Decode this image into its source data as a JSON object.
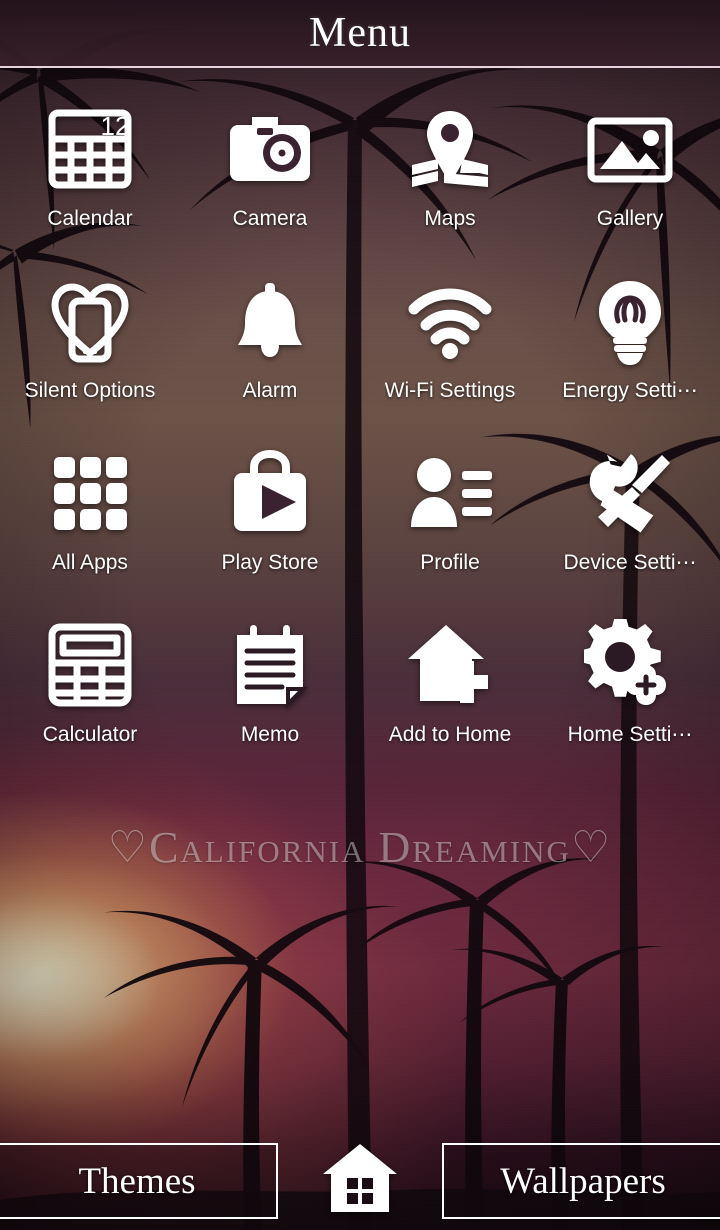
{
  "header": {
    "title": "Menu"
  },
  "apps": [
    {
      "label": "Calendar",
      "icon": "calendar-icon",
      "badge": "12"
    },
    {
      "label": "Camera",
      "icon": "camera-icon"
    },
    {
      "label": "Maps",
      "icon": "map-pin-icon"
    },
    {
      "label": "Gallery",
      "icon": "photo-icon"
    },
    {
      "label": "Silent Options",
      "icon": "heart-phone-icon"
    },
    {
      "label": "Alarm",
      "icon": "bell-icon"
    },
    {
      "label": "Wi-Fi Settings",
      "icon": "wifi-icon"
    },
    {
      "label": "Energy Setti⋯",
      "icon": "lightbulb-icon"
    },
    {
      "label": "All Apps",
      "icon": "grid-apps-icon"
    },
    {
      "label": "Play Store",
      "icon": "play-store-bag-icon"
    },
    {
      "label": "Profile",
      "icon": "person-list-icon"
    },
    {
      "label": "Device Setti⋯",
      "icon": "wrench-screwdriver-icon"
    },
    {
      "label": "Calculator",
      "icon": "calculator-icon"
    },
    {
      "label": "Memo",
      "icon": "notepad-icon"
    },
    {
      "label": "Add to Home",
      "icon": "house-plus-icon"
    },
    {
      "label": "Home Setti⋯",
      "icon": "gear-plus-icon"
    }
  ],
  "watermark": {
    "text": "♡California Dreaming♡"
  },
  "bottom_bar": {
    "themes_label": "Themes",
    "home_icon": "house-icon",
    "wallpapers_label": "Wallpapers"
  },
  "colors": {
    "icon_white": "#ffffff",
    "header_bg": "#301b24",
    "header_rule": "#e7d3dd",
    "label_text": "#ffffff",
    "wallpaper_sunset_warm": "#f3ad60",
    "wallpaper_plum": "#7a2f46",
    "wallpaper_dark": "#200d17"
  }
}
